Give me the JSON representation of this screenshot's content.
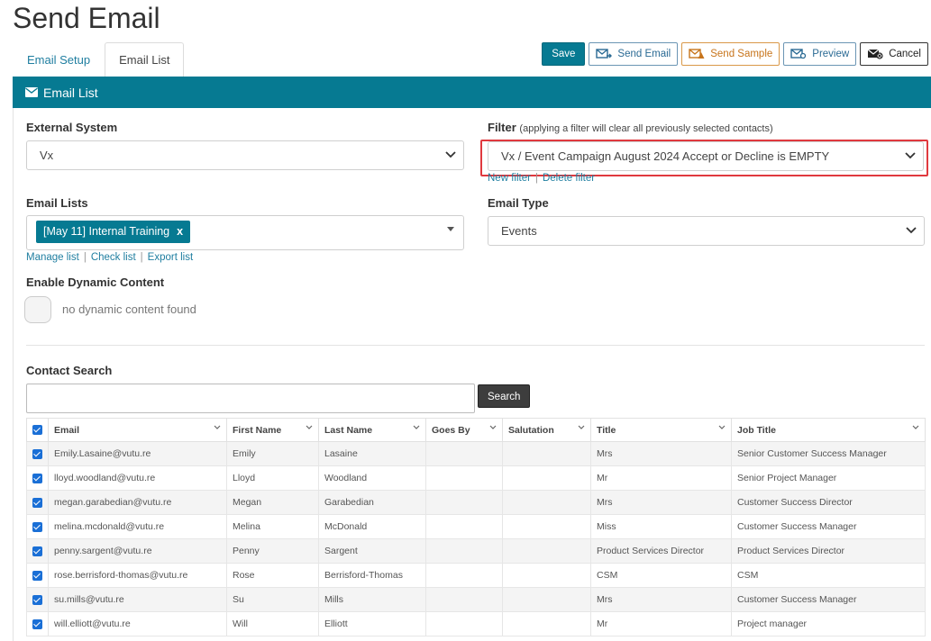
{
  "page": {
    "title": "Send Email"
  },
  "tabs": [
    {
      "label": "Email Setup",
      "active": false
    },
    {
      "label": "Email List",
      "active": true
    }
  ],
  "toolbar": {
    "save": "Save",
    "send_email": "Send Email",
    "send_sample": "Send Sample",
    "preview": "Preview",
    "cancel": "Cancel"
  },
  "panel": {
    "title": "Email List",
    "icon": "envelope-icon"
  },
  "external_system": {
    "label": "External System",
    "value": "Vx"
  },
  "filter": {
    "label": "Filter",
    "note": "(applying a filter will clear all previously selected contacts)",
    "value": "Vx / Event Campaign August 2024 Accept or Decline is EMPTY",
    "links": {
      "new": "New filter",
      "delete": "Delete filter"
    }
  },
  "email_lists": {
    "label": "Email Lists",
    "selected": "[May 11] Internal Training",
    "remove": "x",
    "links": {
      "manage": "Manage list",
      "check": "Check list",
      "export": "Export list"
    }
  },
  "email_type": {
    "label": "Email Type",
    "value": "Events"
  },
  "dynamic": {
    "label": "Enable Dynamic Content",
    "text": "no dynamic content found"
  },
  "contact_search": {
    "label": "Contact Search",
    "value": "",
    "button": "Search"
  },
  "table": {
    "columns": [
      "Email",
      "First Name",
      "Last Name",
      "Goes By",
      "Salutation",
      "Title",
      "Job Title"
    ],
    "rows": [
      {
        "email": "Emily.Lasaine@vutu.re",
        "first": "Emily",
        "last": "Lasaine",
        "goes_by": "",
        "salutation": "",
        "title": "Mrs",
        "job": "Senior Customer Success Manager"
      },
      {
        "email": "lloyd.woodland@vutu.re",
        "first": "Lloyd",
        "last": "Woodland",
        "goes_by": "",
        "salutation": "",
        "title": "Mr",
        "job": "Senior Project Manager"
      },
      {
        "email": "megan.garabedian@vutu.re",
        "first": "Megan",
        "last": "Garabedian",
        "goes_by": "",
        "salutation": "",
        "title": "Mrs",
        "job": "Customer Success Director"
      },
      {
        "email": "melina.mcdonald@vutu.re",
        "first": "Melina",
        "last": "McDonald",
        "goes_by": "",
        "salutation": "",
        "title": "Miss",
        "job": "Customer Success Manager"
      },
      {
        "email": "penny.sargent@vutu.re",
        "first": "Penny",
        "last": "Sargent",
        "goes_by": "",
        "salutation": "",
        "title": "Product Services Director",
        "job": "Product Services Director"
      },
      {
        "email": "rose.berrisford-thomas@vutu.re",
        "first": "Rose",
        "last": "Berrisford-Thomas",
        "goes_by": "",
        "salutation": "",
        "title": "CSM",
        "job": "CSM"
      },
      {
        "email": "su.mills@vutu.re",
        "first": "Su",
        "last": "Mills",
        "goes_by": "",
        "salutation": "",
        "title": "Mrs",
        "job": "Customer Success Manager"
      },
      {
        "email": "will.elliott@vutu.re",
        "first": "Will",
        "last": "Elliott",
        "goes_by": "",
        "salutation": "",
        "title": "Mr",
        "job": "Project manager"
      }
    ]
  },
  "colors": {
    "accent": "#067a92",
    "link": "#1f7ea0",
    "highlight": "#e0393e",
    "sample": "#c7741b"
  }
}
